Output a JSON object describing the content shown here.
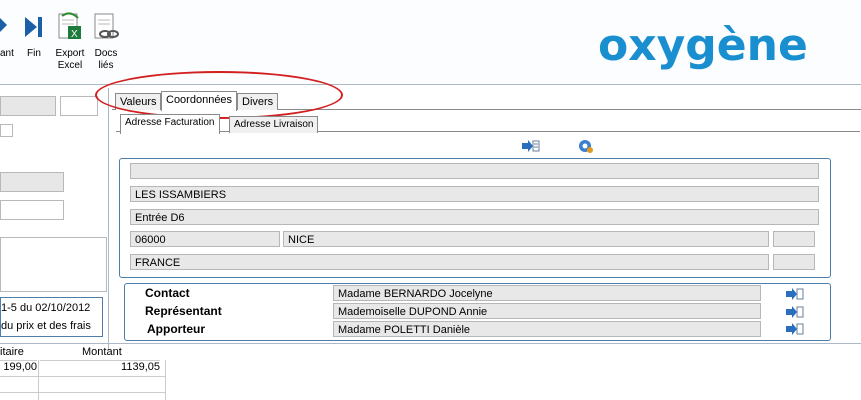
{
  "toolbar": {
    "partial_label": "ant",
    "fin_label": "Fin",
    "export_label_1": "Export",
    "export_label_2": "Excel",
    "docs_label_1": "Docs",
    "docs_label_2": "liés"
  },
  "logo_text": "oxygène",
  "left_panel": {
    "ref_line": "1-5 du 02/10/2012",
    "price_line": "du prix et des frais"
  },
  "tabs": {
    "valeurs": "Valeurs",
    "coordonnees": "Coordonnées",
    "divers": "Divers"
  },
  "subtabs": {
    "facturation": "Adresse Facturation",
    "livraison": "Adresse Livraison"
  },
  "address": {
    "line1": "",
    "line2": "LES ISSAMBIERS",
    "line3": "Entrée D6",
    "postal_code": "06000",
    "city": "NICE",
    "country": "FRANCE"
  },
  "contacts": {
    "contact_label": "Contact",
    "contact_value": "Madame BERNARDO Jocelyne",
    "representant_label": "Représentant",
    "representant_value": "Mademoiselle DUPOND Annie",
    "apporteur_label": "Apporteur",
    "apporteur_value": "Madame POLETTI Danièle"
  },
  "grid": {
    "col_unitaire": "itaire",
    "col_montant": "Montant",
    "row1_unitaire": "199,00",
    "row1_montant": "1139,05"
  },
  "colors": {
    "logo": "#1a8fd0",
    "highlight_ellipse": "#d21f1f",
    "panel_border": "#4d7ea9"
  }
}
